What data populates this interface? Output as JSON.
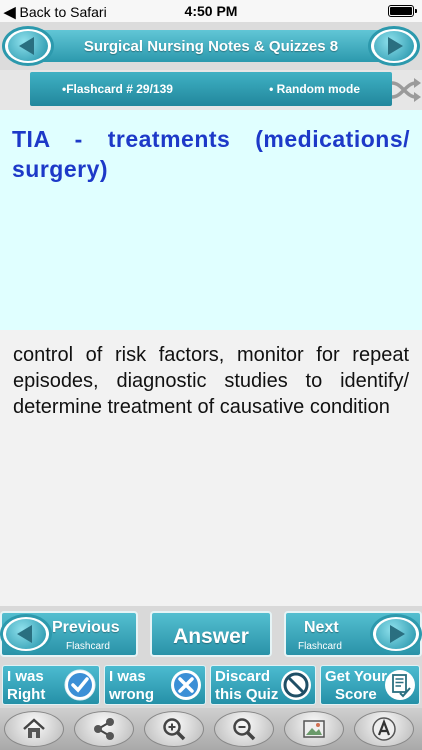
{
  "status_bar": {
    "back_label": "Back to Safari",
    "time": "4:50 PM"
  },
  "header": {
    "title": "Surgical Nursing Notes & Quizzes 8"
  },
  "info_bar": {
    "flashcard_label": "•Flashcard # 29/139",
    "mode_label": "• Random mode"
  },
  "question": "TIA - treatments (medications/ surgery)",
  "answer": "control of risk factors, monitor for repeat episodes, diagnostic studies to identify/ determine treatment of causative condition",
  "nav": {
    "previous": {
      "label": "Previous",
      "sub": "Flashcard"
    },
    "answer": {
      "label": "Answer"
    },
    "next": {
      "label": "Next",
      "sub": "Flashcard"
    }
  },
  "quiz": {
    "right": {
      "line1": "I was",
      "line2": "Right"
    },
    "wrong": {
      "line1": "I was",
      "line2": "wrong"
    },
    "discard": {
      "line1": "Discard",
      "line2": "this Quiz"
    },
    "score": {
      "line1": "Get Your",
      "line2": "Score"
    }
  },
  "toolbar_icons": [
    "home-icon",
    "share-icon",
    "zoom-in-icon",
    "zoom-out-icon",
    "photo-icon",
    "font-icon"
  ],
  "colors": {
    "accent": "#2c99ad",
    "question_text": "#1d39c8",
    "question_bg": "#e0ffff",
    "check": "#3b8fd6",
    "discard_icon": "#1f4f66"
  }
}
